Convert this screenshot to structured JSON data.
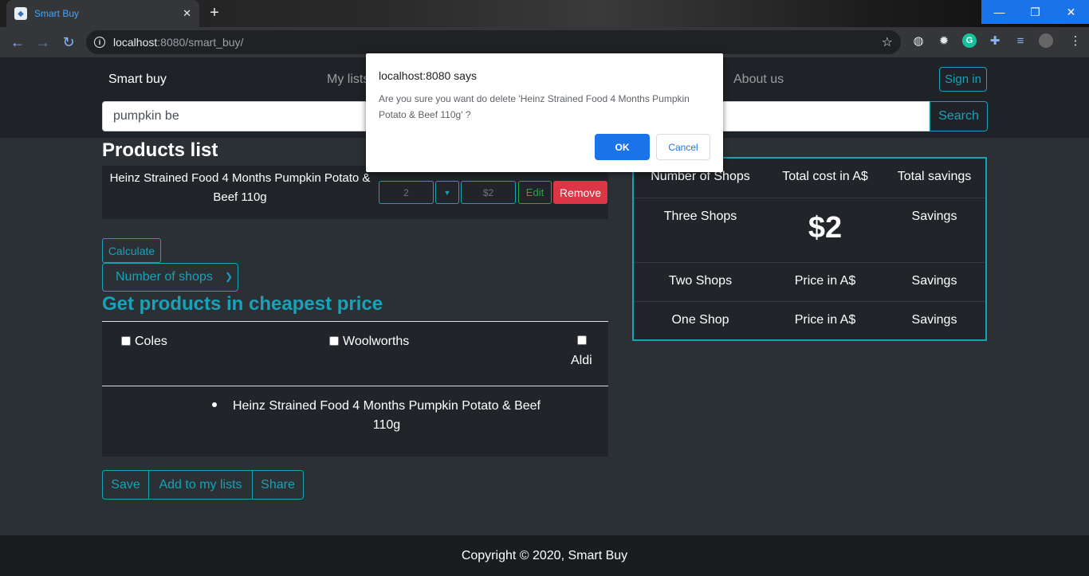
{
  "browser": {
    "tab_title": "Smart Buy",
    "tab_close": "✕",
    "new_tab": "+",
    "url_host": "localhost",
    "url_path": ":8080/smart_buy/",
    "window_buttons": {
      "minimize": "—",
      "restore": "❐",
      "close": "✕"
    }
  },
  "navbar": {
    "brand": "Smart buy",
    "links": [
      "My lists",
      "About us"
    ],
    "signin": "Sign in"
  },
  "search": {
    "value": "pumpkin be",
    "button": "Search"
  },
  "products": {
    "heading": "Products list",
    "items": [
      {
        "name": "Heinz Strained Food 4 Months Pumpkin Potato & Beef 110g",
        "quantity": "2",
        "price": "$2",
        "edit": "Edit",
        "remove": "Remove"
      }
    ]
  },
  "calculate": {
    "button": "Calculate",
    "shops_select": "Number of shops"
  },
  "cheapest": {
    "heading": "Get products in cheapest price",
    "stores": [
      "Coles",
      "Woolworths",
      "Aldi"
    ],
    "results": [
      "Heinz Strained Food 4 Months Pumpkin Potato & Beef 110g"
    ]
  },
  "actions": {
    "save": "Save",
    "add_to_lists": "Add to my lists",
    "share": "Share"
  },
  "summary": {
    "headers": [
      "Number of Shops",
      "Total cost in A$",
      "Total savings"
    ],
    "rows": [
      {
        "shops": "Three Shops",
        "cost": "$2",
        "savings": "Savings"
      },
      {
        "shops": "Two Shops",
        "cost": "Price in A$",
        "savings": "Savings"
      },
      {
        "shops": "One Shop",
        "cost": "Price in A$",
        "savings": "Savings"
      }
    ]
  },
  "footer": {
    "text": "Copyright © 2020, Smart Buy"
  },
  "dialog": {
    "title": "localhost:8080 says",
    "message": "Are you sure you want do delete 'Heinz Strained Food 4 Months Pumpkin Potato & Beef 110g' ?",
    "ok": "OK",
    "cancel": "Cancel"
  },
  "colors": {
    "accent": "#17a2b8",
    "danger": "#dc3545",
    "success": "#28a745",
    "page_bg": "#2b3035",
    "dialog_button": "#1a73e8"
  }
}
